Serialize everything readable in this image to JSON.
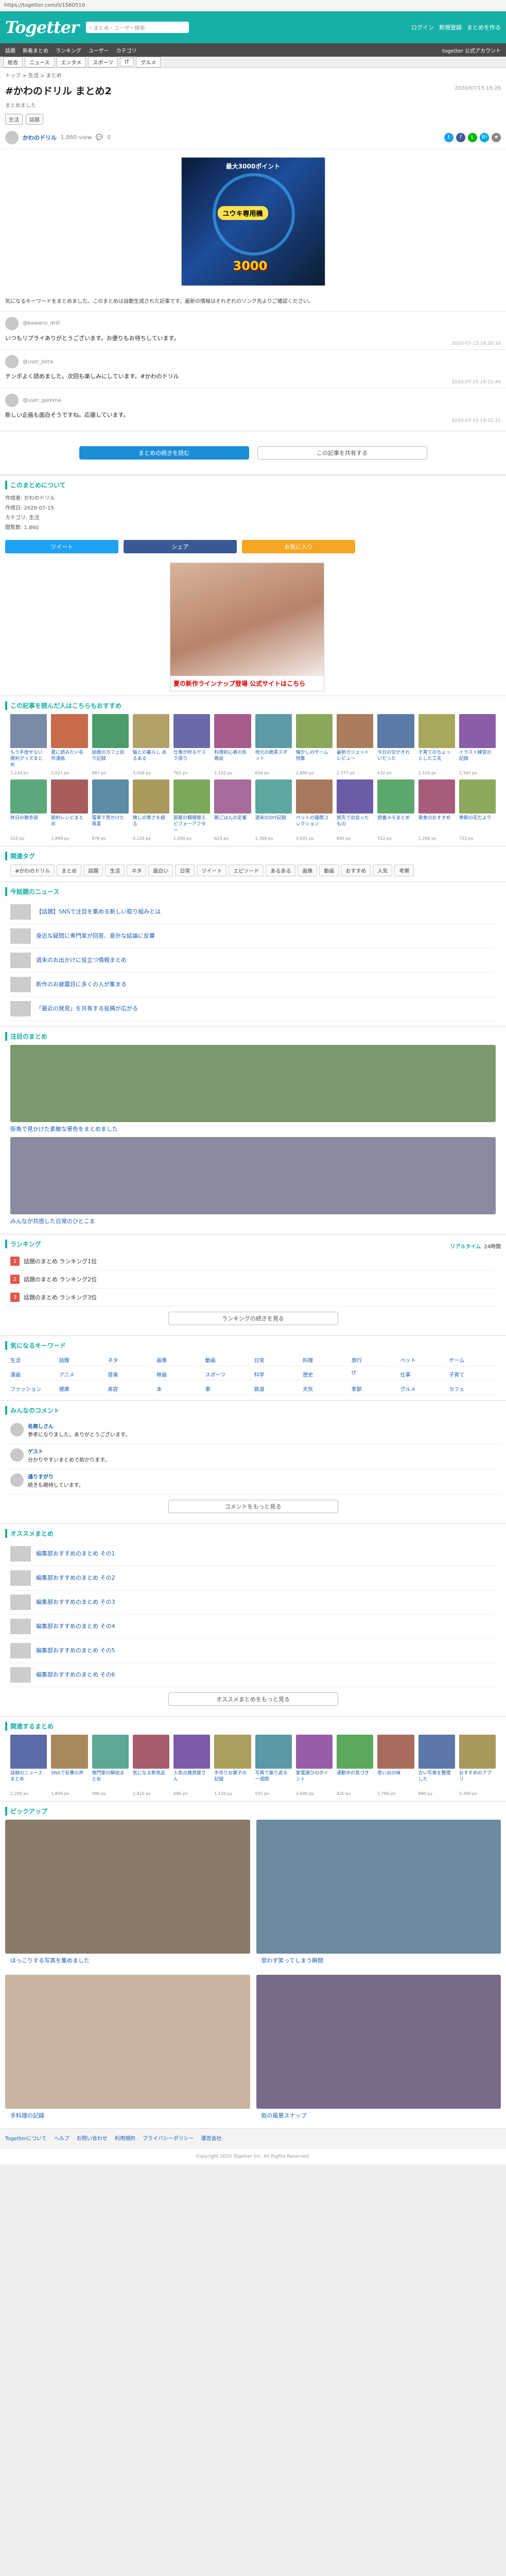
{
  "addr": "https://togetter.com/li/1560510",
  "header": {
    "logo": "Togetter",
    "search_placeholder": "まとめ・ユーザー検索",
    "nav": [
      "ログイン",
      "新規登録",
      "まとめを作る"
    ],
    "subnav": [
      "話題",
      "新着まとめ",
      "ランキング",
      "ユーザー",
      "カテゴリ",
      "togetter 公式アカウント"
    ]
  },
  "tabs": [
    "総合",
    "ニュース",
    "エンタメ",
    "スポーツ",
    "IT",
    "グルメ"
  ],
  "breadcrumb": "トップ > 生活 > まとめ",
  "title": "#かわのドリル まとめ2",
  "date": "2020/07/15 19:26",
  "subtitle": "まとめました",
  "chips": [
    "生活",
    "話題"
  ],
  "author": {
    "name": "かわのドリル",
    "views": "1,860 view",
    "comments": "0"
  },
  "share_icons": [
    {
      "name": "twitter-icon",
      "glyph": "t",
      "color": "#1da1f2"
    },
    {
      "name": "facebook-icon",
      "glyph": "f",
      "color": "#3b5998"
    },
    {
      "name": "line-icon",
      "glyph": "L",
      "color": "#00b900"
    },
    {
      "name": "hatena-icon",
      "glyph": "B!",
      "color": "#00a4de"
    },
    {
      "name": "bookmark-icon",
      "glyph": "★",
      "color": "#888888"
    }
  ],
  "ad_hero": {
    "top": "最大3000ポイント",
    "pill": "ユウキ専用機",
    "big": "3000"
  },
  "description": "気になるキーワードをまとめました。このまとめは自動生成された記事です。最新の情報はそれぞれのリンク先よりご確認ください。",
  "tweets": [
    {
      "user": "@kawano_drill",
      "text": "いつもリプライありがとうございます。お便りもお待ちしています。",
      "meta": "2020-07-15 19:20:10"
    },
    {
      "user": "@user_beta",
      "text": "テンポよく読めました。次回も楽しみにしています。#かわのドリル",
      "meta": "2020-07-15 19:21:44"
    },
    {
      "user": "@user_gamma",
      "text": "新しい企画も面白そうですね。応援しています。",
      "meta": "2020-07-15 19:22:31"
    }
  ],
  "more": {
    "primary": "まとめの続きを読む",
    "secondary": "この記事を共有する"
  },
  "info": {
    "heading": "このまとめについて",
    "rows": [
      "作成者: かわのドリル",
      "作成日: 2020-07-15",
      "カテゴリ: 生活",
      "閲覧数: 1,860"
    ]
  },
  "bigshare": [
    {
      "label": "ツイート",
      "color": "#1da1f2"
    },
    {
      "label": "シェア",
      "color": "#3b5998"
    },
    {
      "label": "お気に入り",
      "color": "#f5a623"
    }
  ],
  "ad_box": {
    "caption": "夏の新作ラインナップ登場 公式サイトはこちら"
  },
  "sections": [
    {
      "heading": "この記事を読んだ人はこちらもおすすめ",
      "cards": [
        {
          "title": "もう手放せない便利グッズまとめ",
          "meta": "1,234 pv",
          "color": "#7b8aa8"
        },
        {
          "title": "夏に読みたい名作漫画",
          "meta": "2,021 pv",
          "color": "#c76b4a"
        },
        {
          "title": "話題のカフェ巡り記録",
          "meta": "987 pv",
          "color": "#4a9d6b"
        },
        {
          "title": "猫との暮らし あるある",
          "meta": "3,456 pv",
          "color": "#b2a26a"
        },
        {
          "title": "仕事が捗るデスク周り",
          "meta": "765 pv",
          "color": "#6a6aa8"
        },
        {
          "title": "料理初心者の失敗談",
          "meta": "1,102 pv",
          "color": "#a85c8b"
        },
        {
          "title": "地元の絶景スポット",
          "meta": "654 pv",
          "color": "#5c9aa8"
        },
        {
          "title": "懐かしのゲーム特集",
          "meta": "2,890 pv",
          "color": "#8aa85c"
        },
        {
          "title": "最新ガジェットレビュー",
          "meta": "1,777 pv",
          "color": "#a87c5c"
        },
        {
          "title": "今日の空がきれいだった",
          "meta": "432 pv",
          "color": "#5c7ca8"
        },
        {
          "title": "子育てのちょっとした工夫",
          "meta": "1,520 pv",
          "color": "#a8a85c"
        },
        {
          "title": "イラスト練習の記録",
          "meta": "2,345 pv",
          "color": "#8c5ca8"
        },
        {
          "title": "休日の散歩道",
          "meta": "310 pv",
          "color": "#5ca87c"
        },
        {
          "title": "節約レシピまとめ",
          "meta": "1,999 pv",
          "color": "#a85c5c"
        },
        {
          "title": "電車で見かけた風景",
          "meta": "876 pv",
          "color": "#5c8ca8"
        },
        {
          "title": "推しの尊さを語る",
          "meta": "4,120 pv",
          "color": "#a89a5c"
        },
        {
          "title": "部屋の模様替えビフォーアフター",
          "meta": "1,040 pv",
          "color": "#7ca85c"
        },
        {
          "title": "朝ごはんの定番",
          "meta": "623 pv",
          "color": "#a86c9c"
        },
        {
          "title": "週末のDIY記録",
          "meta": "1,386 pv",
          "color": "#5ca8a0"
        },
        {
          "title": "ペットの寝顔コレクション",
          "meta": "3,001 pv",
          "color": "#a8785c"
        },
        {
          "title": "旅先で出会ったもの",
          "meta": "845 pv",
          "color": "#6c5ca8"
        },
        {
          "title": "読書メモまとめ",
          "meta": "512 pv",
          "color": "#5ca86c"
        },
        {
          "title": "夜食のおすすめ",
          "meta": "1,268 pv",
          "color": "#a85c7c"
        },
        {
          "title": "季節の花だより",
          "meta": "733 pv",
          "color": "#8ca85c"
        }
      ]
    },
    {
      "heading": "関連するまとめ",
      "cards": [
        {
          "title": "話題のニュースまとめ",
          "meta": "2,200 pv",
          "color": "#5c6ca8"
        },
        {
          "title": "SNSで反響の声",
          "meta": "1,850 pv",
          "color": "#a8885c"
        },
        {
          "title": "専門家の解説まとめ",
          "meta": "990 pv",
          "color": "#5ca898"
        },
        {
          "title": "気になる新商品",
          "meta": "1,410 pv",
          "color": "#a85c6c"
        },
        {
          "title": "人気の雑貨屋さん",
          "meta": "680 pv",
          "color": "#7c5ca8"
        },
        {
          "title": "手作りお菓子の記録",
          "meta": "1,120 pv",
          "color": "#a8a05c"
        },
        {
          "title": "写真で振り返る一週間",
          "meta": "555 pv",
          "color": "#5c98a8"
        },
        {
          "title": "家電選びのポイント",
          "meta": "2,600 pv",
          "color": "#985ca8"
        },
        {
          "title": "通勤中の気づき",
          "meta": "420 pv",
          "color": "#5ca85c"
        },
        {
          "title": "思い出の味",
          "meta": "1,780 pv",
          "color": "#a86c5c"
        },
        {
          "title": "古い写真を整理した",
          "meta": "890 pv",
          "color": "#5c78a8"
        },
        {
          "title": "おすすめのアプリ",
          "meta": "3,300 pv",
          "color": "#a8985c"
        }
      ]
    }
  ],
  "tags_heading": "関連タグ",
  "tags": [
    "#かわのドリル",
    "まとめ",
    "話題",
    "生活",
    "ネタ",
    "面白い",
    "日常",
    "ツイート",
    "エピソード",
    "あるある",
    "画像",
    "動画",
    "おすすめ",
    "人気",
    "考察"
  ],
  "news_heading": "今話題のニュース",
  "news": [
    "【話題】SNSで注目を集める新しい取り組みとは",
    "身近な疑問に専門家が回答、意外な結論に反響",
    "週末のお出かけに役立つ情報まとめ",
    "新作のお披露目に多くの人が集まる",
    "「最近の発見」を共有する投稿が広がる"
  ],
  "wide_heading": "注目のまとめ",
  "wide": [
    {
      "title": "街角で見かけた素敵な景色をまとめました",
      "color": "#7c9a6c"
    },
    {
      "title": "みんなが共感した日常のひとこま",
      "color": "#8a8aa0"
    }
  ],
  "ranking": {
    "heading": "ランキング",
    "tab_realtime": "リアルタイム",
    "tab_24h": "24時間",
    "items": [
      "話題のまとめ ランキング1位",
      "話題のまとめ ランキング2位",
      "話題のまとめ ランキング3位"
    ],
    "more": "ランキングの続きを見る"
  },
  "keywords_heading": "気になるキーワード",
  "keywords": [
    "生活",
    "話題",
    "ネタ",
    "画像",
    "動画",
    "日常",
    "料理",
    "旅行",
    "ペット",
    "ゲーム",
    "漫画",
    "アニメ",
    "音楽",
    "映画",
    "スポーツ",
    "科学",
    "歴史",
    "IT",
    "仕事",
    "子育て",
    "ファッション",
    "健康",
    "美容",
    "本",
    "車",
    "鉄道",
    "天気",
    "季節",
    "グルメ",
    "カフェ"
  ],
  "comments": {
    "heading": "みんなのコメント",
    "items": [
      {
        "name": "名無しさん",
        "text": "参考になりました。ありがとうございます。"
      },
      {
        "name": "ゲスト",
        "text": "分かりやすいまとめで助かります。"
      },
      {
        "name": "通りすがり",
        "text": "続きも期待しています。"
      }
    ],
    "more": "コメントをもっと見る"
  },
  "recommend_heading": "オススメまとめ",
  "recommend": [
    "編集部おすすめのまとめ その1",
    "編集部おすすめのまとめ その2",
    "編集部おすすめのまとめ その3",
    "編集部おすすめのまとめ その4",
    "編集部おすすめのまとめ その5",
    "編集部おすすめのまとめ その6"
  ],
  "recommend_more": "オススメまとめをもっと見る",
  "big_heading": "ピックアップ",
  "big": [
    {
      "title": "ほっこりする写真を集めました",
      "color": "#8a7a6a"
    },
    {
      "title": "思わず笑ってしまう瞬間",
      "color": "#6a8aa0"
    },
    {
      "title": "手料理の記録",
      "color": "#c8b4a0"
    },
    {
      "title": "街の風景スナップ",
      "color": "#7a6a8a"
    }
  ],
  "footer": {
    "links": [
      "Togetterについて",
      "ヘルプ",
      "お問い合わせ",
      "利用規約",
      "プライバシーポリシー",
      "運営会社"
    ],
    "copyright": "Copyright 2020 Togetter Inc. All Rights Reserved."
  }
}
